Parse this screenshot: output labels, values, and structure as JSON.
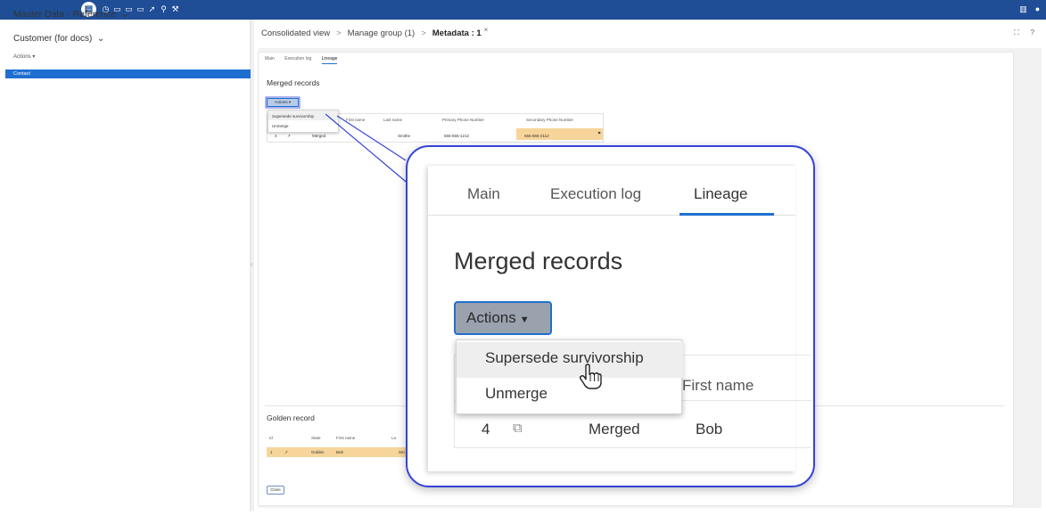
{
  "topbar": {
    "icons": [
      "home-icon",
      "clock-icon",
      "doc-icon",
      "doc-icon",
      "doc-icon",
      "pin-icon",
      "search-icon",
      "wrench-icon"
    ],
    "right_icons": [
      "book-icon",
      "user-icon"
    ],
    "accent": "#1f4e96"
  },
  "sidebar": {
    "title": "Master Data - Reference",
    "title_caret": "⌄",
    "subtitle": "Customer (for docs)",
    "subtitle_caret": "⌄",
    "actions": "Actions ▾",
    "selected_item": "Contact",
    "selected_color": "#1f6fd1"
  },
  "breadcrumb": {
    "items": [
      "Consolidated view",
      "Manage group (1)",
      "Metadata : 1"
    ],
    "separator": ">",
    "close": "×"
  },
  "header_icons": [
    "expand-icon",
    "help-icon"
  ],
  "header_icon_glyphs": [
    "⛶",
    "?"
  ],
  "tabs": [
    "Main",
    "Execution log",
    "Lineage"
  ],
  "active_tab": "Lineage",
  "merged": {
    "title": "Merged records",
    "actions_label": "Actions",
    "menu": [
      "Supersede survivorship",
      "Unmerge"
    ],
    "columns": [
      "First name",
      "Last name",
      "Primary Phone Number",
      "Secondary Phone Number"
    ],
    "row": {
      "id": "4",
      "state": "Merged",
      "first_name": "Bob",
      "last_name": "Smithe",
      "primary_phone": "555-555-1212",
      "secondary_phone": "555-656-2112"
    }
  },
  "golden": {
    "title": "Golden record",
    "columns": [
      "Id",
      "State",
      "First name",
      "La"
    ],
    "row": {
      "id": "1",
      "state": "Golden",
      "first_name": "Bob",
      "last": "Sm"
    }
  },
  "close_button": "Close",
  "zoom": {
    "tabs": [
      "Main",
      "Execution log",
      "Lineage"
    ],
    "active_tab": "Lineage",
    "title": "Merged records",
    "actions_label": "Actions",
    "menu": [
      "Supersede survivorship",
      "Unmerge"
    ],
    "column_first_name": "First name",
    "row": {
      "id": "4",
      "state": "Merged",
      "first_name": "Bob"
    },
    "border_color": "#3344d6",
    "highlight": "#f7d59a"
  }
}
